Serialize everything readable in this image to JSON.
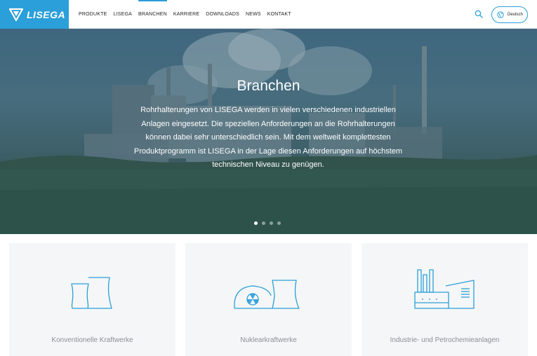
{
  "brand": {
    "name": "LISEGA",
    "color": "#2a9fd9"
  },
  "nav": {
    "items": [
      {
        "label": "PRODUKTE"
      },
      {
        "label": "LISEGA"
      },
      {
        "label": "BRANCHEN"
      },
      {
        "label": "KARRIERE"
      },
      {
        "label": "DOWNLOADS"
      },
      {
        "label": "NEWS"
      },
      {
        "label": "KONTAKT"
      }
    ],
    "active": "BRANCHEN"
  },
  "header": {
    "search_icon": "search-icon",
    "language": "Deutsch",
    "language_icon": "globe-icon"
  },
  "hero": {
    "title": "Branchen",
    "text": "Rohrhalterungen von LISEGA werden in vielen verschiedenen industriellen Anlagen eingesetzt. Die speziellen Anforderungen an die Rohrhalterungen können dabei sehr unterschiedlich sein. Mit dem weltweit komplettesten Produktprogramm ist LISEGA in der Lage diesen Anforderungen auf höchstem technischen Niveau zu genügen.",
    "slides": 4,
    "active_slide": 1
  },
  "cards": [
    {
      "title": "Konventionelle Kraftwerke",
      "icon": "cooling-tower-icon"
    },
    {
      "title": "Nuklearkraftwerke",
      "icon": "nuclear-plant-icon"
    },
    {
      "title": "Industrie- und Petrochemieanlagen",
      "icon": "factory-icon"
    }
  ]
}
